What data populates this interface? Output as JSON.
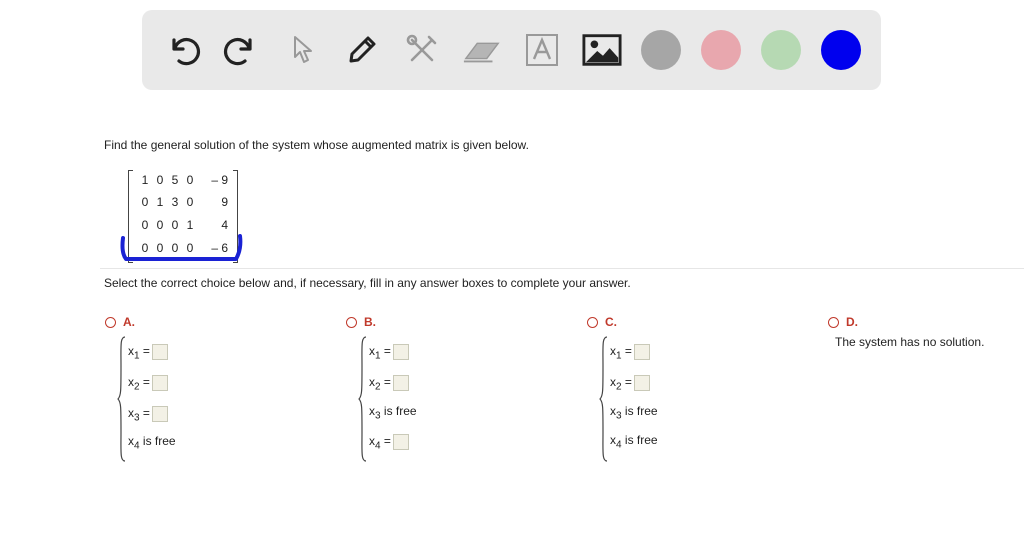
{
  "toolbar": {
    "tools": [
      "undo-icon",
      "redo-icon",
      "pointer-icon",
      "pen-icon",
      "tools-icon",
      "eraser-icon",
      "text-icon",
      "image-icon"
    ],
    "colors": [
      "#a6a6a6",
      "#e8a7ae",
      "#b6d9b3",
      "#0000ee"
    ]
  },
  "question": {
    "text": "Find the general solution of the system whose augmented matrix is given below."
  },
  "matrix": {
    "rows": [
      {
        "c1": "1",
        "c2": "0",
        "c3": "5",
        "c4": "0",
        "rhs": "– 9"
      },
      {
        "c1": "0",
        "c2": "1",
        "c3": "3",
        "c4": "0",
        "rhs": "9"
      },
      {
        "c1": "0",
        "c2": "0",
        "c3": "0",
        "c4": "1",
        "rhs": "4"
      },
      {
        "c1": "0",
        "c2": "0",
        "c3": "0",
        "c4": "0",
        "rhs": "– 6"
      }
    ],
    "annotation_color": "#1a22d4"
  },
  "instruction": "Select the correct choice below and, if necessary, fill in any answer boxes to complete your answer.",
  "choices": {
    "a": {
      "label": "A.",
      "x1": "x",
      "s1": "1",
      "x2": "x",
      "s2": "2",
      "x3": "x",
      "s3": "3",
      "x4": "x",
      "s4": "4",
      "eq": "=",
      "free": "is free"
    },
    "b": {
      "label": "B.",
      "x1": "x",
      "s1": "1",
      "x2": "x",
      "s2": "2",
      "x3": "x",
      "s3": "3",
      "x4": "x",
      "s4": "4",
      "eq": "=",
      "free": "is free"
    },
    "c": {
      "label": "C.",
      "x1": "x",
      "s1": "1",
      "x2": "x",
      "s2": "2",
      "x3": "x",
      "s3": "3",
      "x4": "x",
      "s4": "4",
      "eq": "=",
      "free": "is free"
    },
    "d": {
      "label": "D.",
      "text": "The system has no solution."
    }
  }
}
